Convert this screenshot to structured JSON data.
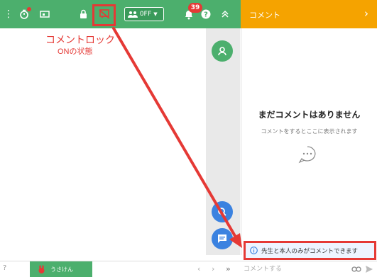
{
  "toolbar": {
    "toggle_label": "OFF",
    "notification_count": "39"
  },
  "callout": {
    "title": "コメントロック",
    "subtitle": "ONの状態"
  },
  "comment_panel": {
    "title": "コメント",
    "empty_title": "まだコメントはありません",
    "empty_subtitle": "コメントをするとここに表示されます",
    "info_text": "先生と本人のみがコメントできます",
    "input_placeholder": "コメントする"
  },
  "bottom": {
    "user_name": "うさけん"
  },
  "colors": {
    "toolbar_green": "#4caf6d",
    "panel_orange": "#f5a300",
    "highlight_red": "#e53935"
  }
}
